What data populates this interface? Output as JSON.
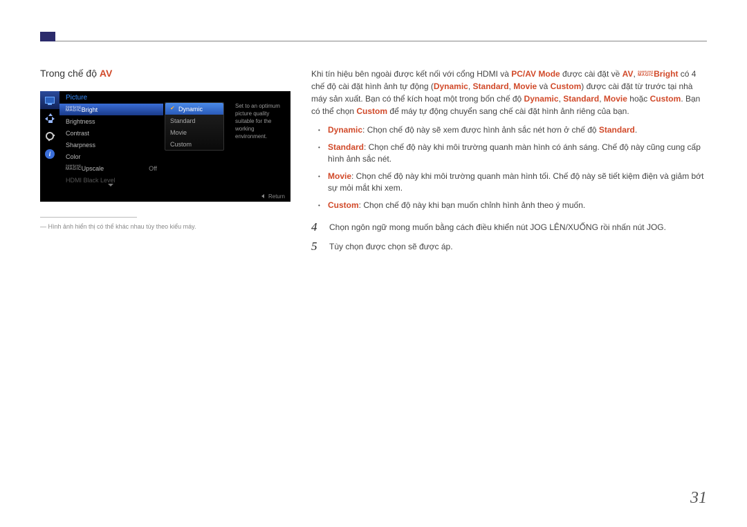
{
  "page_number": "31",
  "left": {
    "title_prefix": "Trong chế độ ",
    "title_mode": "AV",
    "note": "― Hình ảnh hiển thị có thể khác nhau tùy theo kiểu máy."
  },
  "osd": {
    "header": "Picture",
    "menu_items": [
      {
        "label_pre_magic": true,
        "label": "Bright",
        "highlight": true
      },
      {
        "label": "Brightness"
      },
      {
        "label": "Contrast"
      },
      {
        "label": "Sharpness"
      },
      {
        "label": "Color"
      },
      {
        "label_pre_magic": true,
        "label": "Upscale",
        "value": "Off"
      },
      {
        "label": "HDMI Black Level",
        "disabled": true
      }
    ],
    "submenu": [
      {
        "label": "Dynamic",
        "selected": true
      },
      {
        "label": "Standard"
      },
      {
        "label": "Movie"
      },
      {
        "label": "Custom"
      }
    ],
    "info_text": "Set to an optimum picture quality suitable for the working environment.",
    "footer_return": "Return"
  },
  "right": {
    "p1_a": "Khi tín hiệu bên ngoài được kết nối với cổng HDMI và ",
    "p1_pcav": "PC/AV Mode",
    "p1_b": " được cài đặt về ",
    "p1_av": "AV",
    "p1_c": ", ",
    "p1_bright": "Bright",
    "p1_d": " có 4 chế độ cài đặt hình ảnh tự động (",
    "p1_dynamic": "Dynamic",
    "p1_sep": ", ",
    "p1_standard": "Standard",
    "p1_movie": "Movie",
    "p1_and": " và ",
    "p1_custom": "Custom",
    "p1_e": ") được cài đặt từ trước tại nhà máy sản xuất. Bạn có thể kích hoạt một trong bốn chế độ ",
    "p1_or": " hoặc ",
    "p1_f": ". Bạn có thể chọn ",
    "p1_g": " để máy tự động chuyển sang chế cài đặt hình ảnh riêng của bạn.",
    "bullets": [
      {
        "lead": "Dynamic",
        "text": ": Chọn chế độ này sẽ xem được hình ảnh sắc nét hơn ở chế độ ",
        "tail_hl": "Standard",
        "tail": "."
      },
      {
        "lead": "Standard",
        "text": ": Chọn chế độ này khi môi trường quanh màn hình có ánh sáng. Chế độ này cũng cung cấp hình ảnh sắc nét."
      },
      {
        "lead": "Movie",
        "text": ": Chọn chế độ này khi môi trường quanh màn hình tối. Chế độ này sẽ tiết kiệm điện và giảm bớt sự mỏi mắt khi xem."
      },
      {
        "lead": "Custom",
        "text": ": Chọn chế độ này khi bạn muốn chỉnh hình ảnh theo ý muốn."
      }
    ],
    "steps": [
      {
        "num": "4",
        "text": "Chọn ngôn ngữ mong muốn bằng cách điều khiển nút JOG LÊN/XUỐNG rồi nhấn nút JOG."
      },
      {
        "num": "5",
        "text": "Tùy chọn được chọn sẽ được áp."
      }
    ]
  }
}
